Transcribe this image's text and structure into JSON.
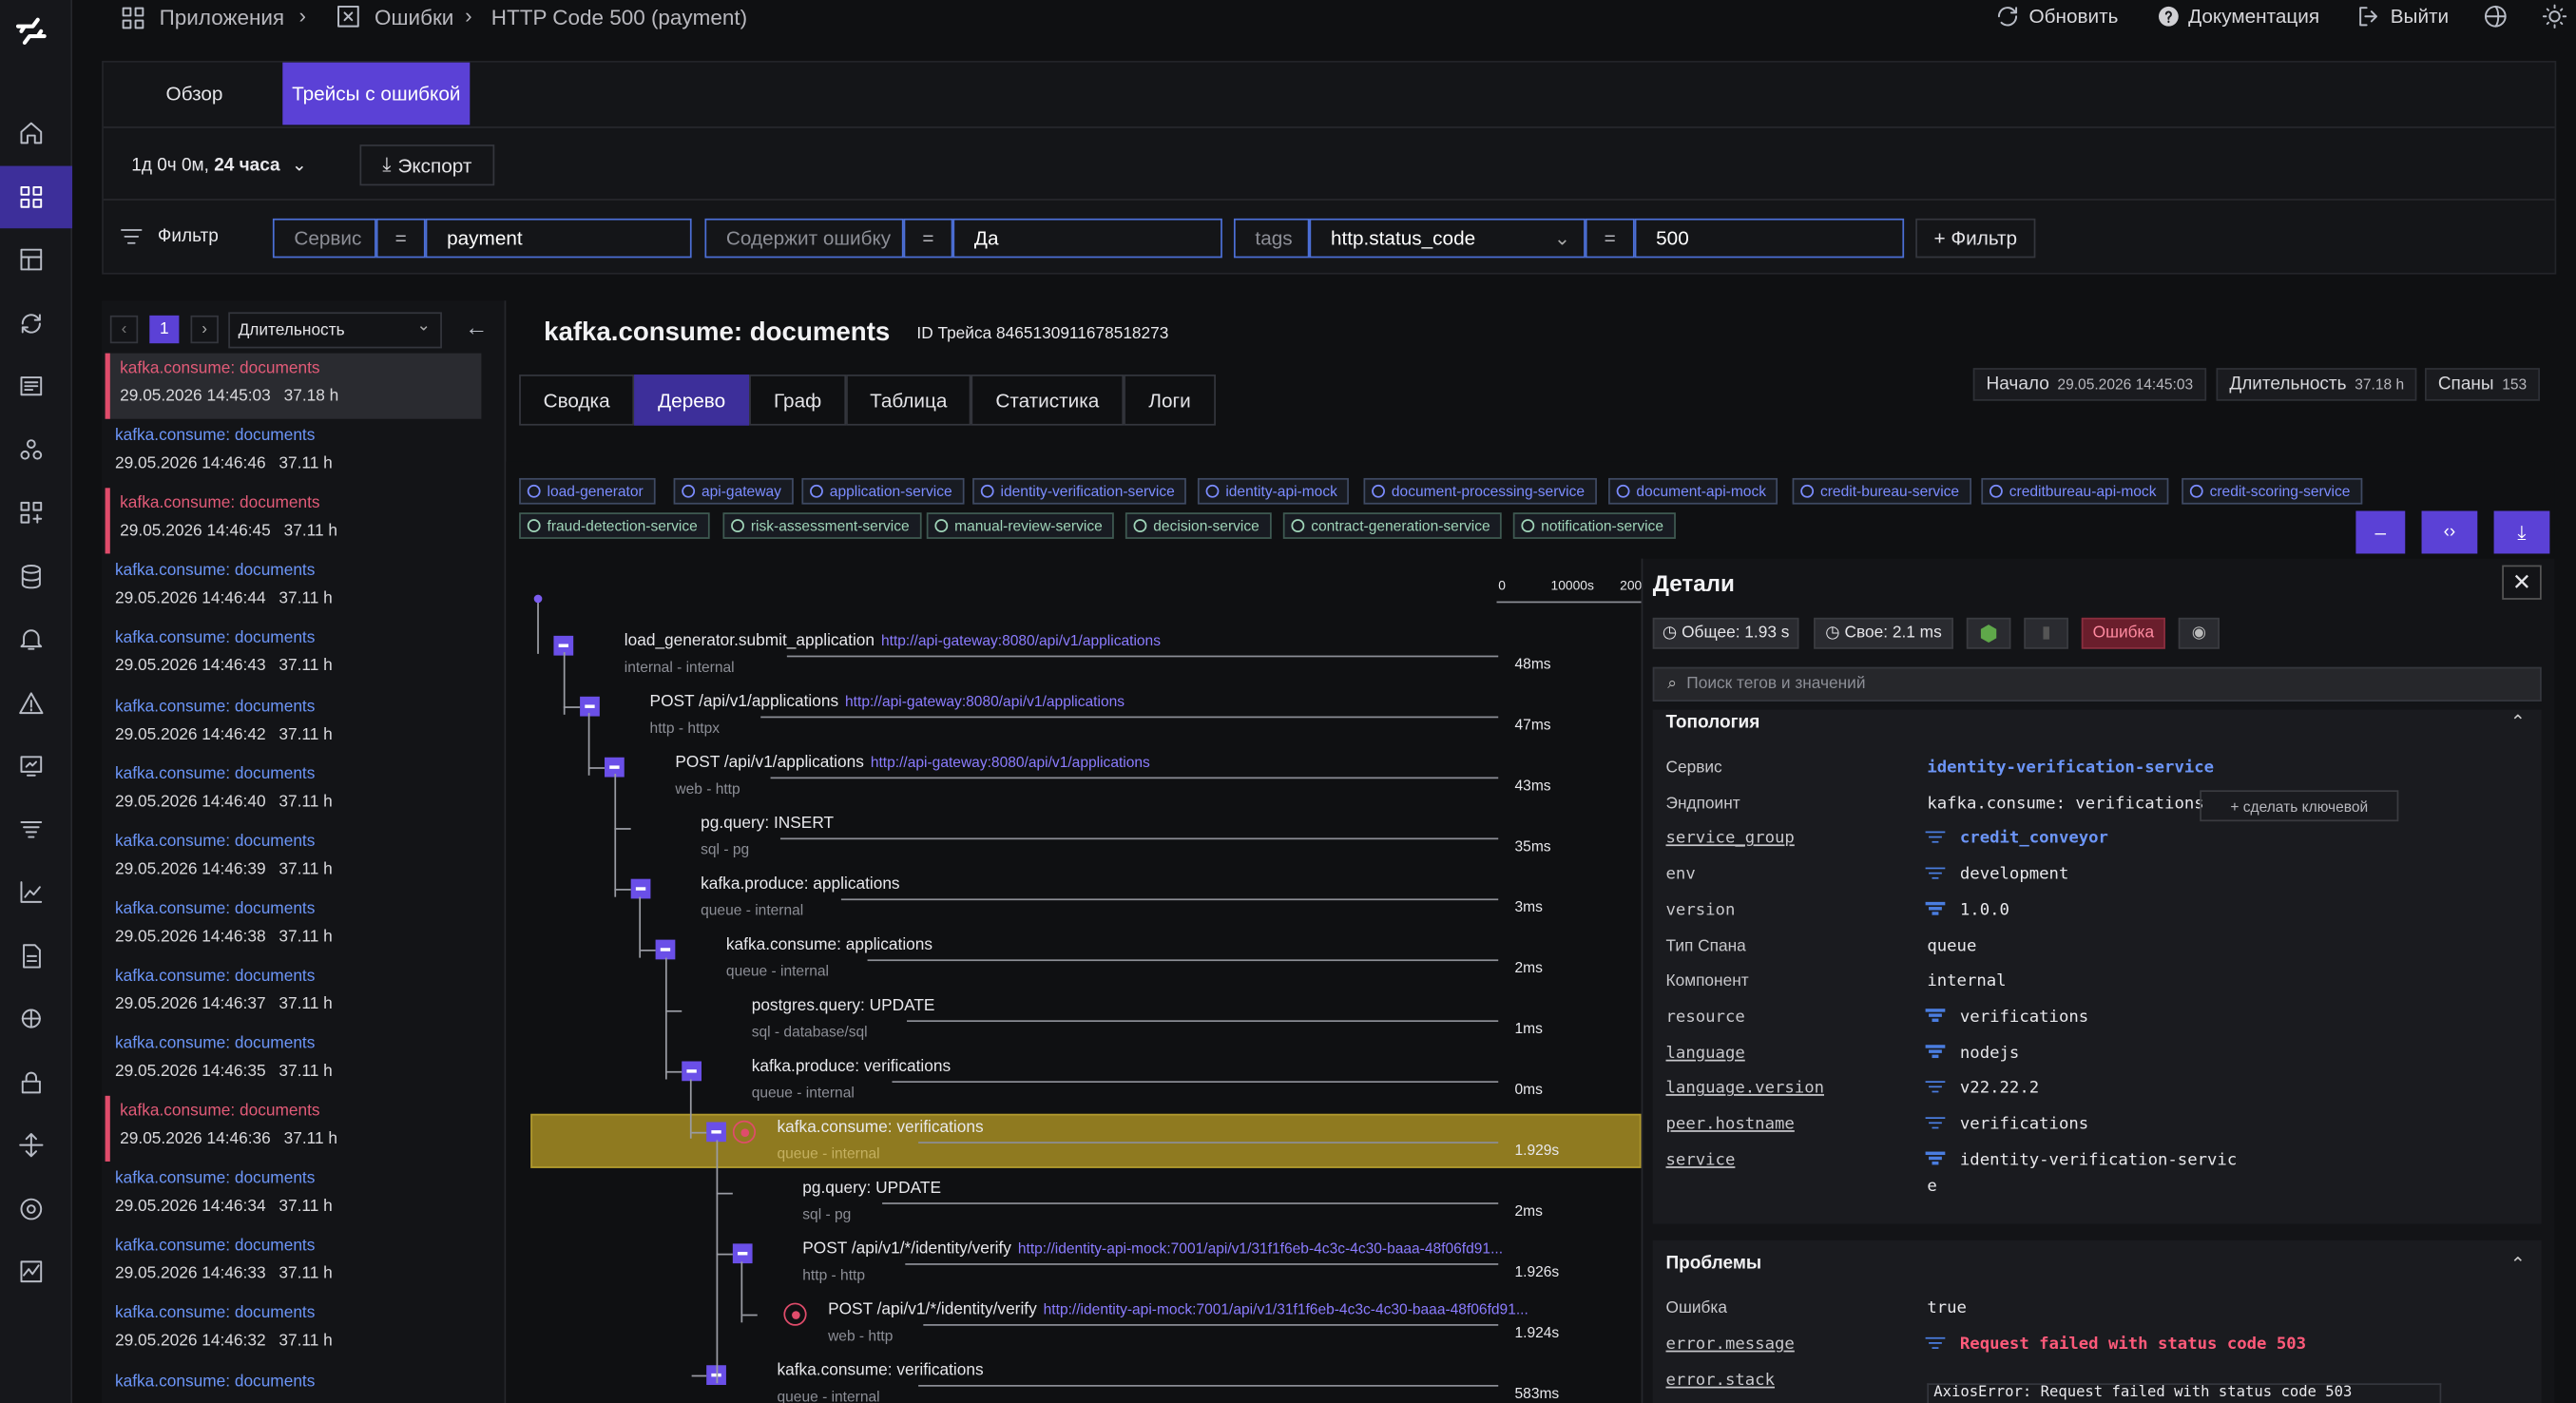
{
  "breadcrumb": {
    "apps": "Приложения",
    "errors": "Ошибки",
    "current": "HTTP Code 500 (payment)"
  },
  "topbar": {
    "refresh": "Обновить",
    "docs": "Документация",
    "logout": "Выйти"
  },
  "page_tabs": {
    "overview": "Обзор",
    "traces": "Трейсы с ошибкой"
  },
  "time_range": {
    "prefix": "1д 0ч 0м,",
    "bold": "24 часа"
  },
  "export_label": "Экспорт",
  "filter": {
    "label": "Фильтр",
    "f1_key": "Сервис",
    "f1_op": "=",
    "f1_val": "payment",
    "f2_key": "Содержит ошибку",
    "f2_op": "=",
    "f2_val": "Да",
    "f3_key": "tags",
    "f3_sub": "http.status_code",
    "f3_op": "=",
    "f3_val": "500",
    "add": "+ Фильтр"
  },
  "list": {
    "page": "1",
    "sort": "Длительность",
    "items": [
      {
        "name": "kafka.consume: documents",
        "date": "29.05.2026 14:45:03",
        "dur": "37.18 h",
        "error": true
      },
      {
        "name": "kafka.consume: documents",
        "date": "29.05.2026 14:46:46",
        "dur": "37.11 h",
        "error": false
      },
      {
        "name": "kafka.consume: documents",
        "date": "29.05.2026 14:46:45",
        "dur": "37.11 h",
        "error": true
      },
      {
        "name": "kafka.consume: documents",
        "date": "29.05.2026 14:46:44",
        "dur": "37.11 h",
        "error": false
      },
      {
        "name": "kafka.consume: documents",
        "date": "29.05.2026 14:46:43",
        "dur": "37.11 h",
        "error": false
      },
      {
        "name": "kafka.consume: documents",
        "date": "29.05.2026 14:46:42",
        "dur": "37.11 h",
        "error": false
      },
      {
        "name": "kafka.consume: documents",
        "date": "29.05.2026 14:46:40",
        "dur": "37.11 h",
        "error": false
      },
      {
        "name": "kafka.consume: documents",
        "date": "29.05.2026 14:46:39",
        "dur": "37.11 h",
        "error": false
      },
      {
        "name": "kafka.consume: documents",
        "date": "29.05.2026 14:46:38",
        "dur": "37.11 h",
        "error": false
      },
      {
        "name": "kafka.consume: documents",
        "date": "29.05.2026 14:46:37",
        "dur": "37.11 h",
        "error": false
      },
      {
        "name": "kafka.consume: documents",
        "date": "29.05.2026 14:46:35",
        "dur": "37.11 h",
        "error": false
      },
      {
        "name": "kafka.consume: documents",
        "date": "29.05.2026 14:46:36",
        "dur": "37.11 h",
        "error": true
      },
      {
        "name": "kafka.consume: documents",
        "date": "29.05.2026 14:46:34",
        "dur": "37.11 h",
        "error": false
      },
      {
        "name": "kafka.consume: documents",
        "date": "29.05.2026 14:46:33",
        "dur": "37.11 h",
        "error": false
      },
      {
        "name": "kafka.consume: documents",
        "date": "29.05.2026 14:46:32",
        "dur": "37.11 h",
        "error": false
      },
      {
        "name": "kafka.consume: documents",
        "date": "",
        "dur": "",
        "error": false
      }
    ]
  },
  "trace": {
    "title": "kafka.consume: documents",
    "id_label": "ID Трейса",
    "id": "8465130911678518273",
    "start_label": "Начало",
    "start": "29.05.2026 14:45:03",
    "duration_label": "Длительность",
    "duration": "37.18 h",
    "spans_label": "Спаны",
    "spans": "153",
    "tabs": [
      "Сводка",
      "Дерево",
      "Граф",
      "Таблица",
      "Статистика",
      "Логи"
    ],
    "services_row1": [
      "load-generator",
      "api-gateway",
      "application-service",
      "identity-verification-service",
      "identity-api-mock",
      "document-processing-service",
      "document-api-mock",
      "credit-bureau-service",
      "creditbureau-api-mock",
      "credit-scoring-service"
    ],
    "services_row2": [
      "fraud-detection-service",
      "risk-assessment-service",
      "manual-review-service",
      "decision-service",
      "contract-generation-service",
      "notification-service"
    ],
    "scale": [
      "0",
      "10000s",
      "200"
    ]
  },
  "spans": [
    {
      "name": "load_generator.submit_application",
      "url": "http://api-gateway:8080/api/v1/applications",
      "sub": "internal - internal",
      "dur": "48ms"
    },
    {
      "name": "POST /api/v1/applications",
      "url": "http://api-gateway:8080/api/v1/applications",
      "sub": "http - httpx",
      "dur": "47ms"
    },
    {
      "name": "POST /api/v1/applications",
      "url": "http://api-gateway:8080/api/v1/applications",
      "sub": "web - http",
      "dur": "43ms"
    },
    {
      "name": "pg.query: INSERT",
      "url": "",
      "sub": "sql - pg",
      "dur": "35ms"
    },
    {
      "name": "kafka.produce: applications",
      "url": "",
      "sub": "queue - internal",
      "dur": "3ms"
    },
    {
      "name": "kafka.consume: applications",
      "url": "",
      "sub": "queue - internal",
      "dur": "2ms"
    },
    {
      "name": "postgres.query: UPDATE",
      "url": "",
      "sub": "sql - database/sql",
      "dur": "1ms"
    },
    {
      "name": "kafka.produce: verifications",
      "url": "",
      "sub": "queue - internal",
      "dur": "0ms"
    },
    {
      "name": "kafka.consume: verifications",
      "url": "",
      "sub": "queue - internal",
      "dur": "1.929s"
    },
    {
      "name": "pg.query: UPDATE",
      "url": "",
      "sub": "sql - pg",
      "dur": "2ms"
    },
    {
      "name": "POST /api/v1/*/identity/verify",
      "url": "http://identity-api-mock:7001/api/v1/31f1f6eb-4c3c-4c30-baaa-48f06fd91...",
      "sub": "http - http",
      "dur": "1.926s"
    },
    {
      "name": "POST /api/v1/*/identity/verify",
      "url": "http://identity-api-mock:7001/api/v1/31f1f6eb-4c3c-4c30-baaa-48f06fd91...",
      "sub": "web - http",
      "dur": "1.924s"
    },
    {
      "name": "kafka.consume: verifications",
      "url": "",
      "sub": "queue - internal",
      "dur": "583ms"
    }
  ],
  "details": {
    "title": "Детали",
    "total": "Общее: 1.93 s",
    "self": "Свое: 2.1 ms",
    "error_badge": "Ошибка",
    "search_placeholder": "Поиск тегов и значений",
    "topology_title": "Топология",
    "make_key": "+ сделать ключевой",
    "rows": [
      {
        "k": "Сервис",
        "v": "identity-verification-service"
      },
      {
        "k": "Эндпоинт",
        "v": "kafka.consume: verifications"
      },
      {
        "k": "service_group",
        "v": "credit_conveyor"
      },
      {
        "k": "env",
        "v": "development"
      },
      {
        "k": "version",
        "v": "1.0.0"
      },
      {
        "k": "Тип Спана",
        "v": "queue"
      },
      {
        "k": "Компонент",
        "v": "internal"
      },
      {
        "k": "resource",
        "v": "verifications"
      },
      {
        "k": "language",
        "v": "nodejs"
      },
      {
        "k": "language.version",
        "v": "v22.22.2"
      },
      {
        "k": "peer.hostname",
        "v": "verifications"
      },
      {
        "k": "service",
        "v": "identity-verification-servic"
      }
    ],
    "service_wrap": "e",
    "problems_title": "Проблемы",
    "prob_rows": [
      {
        "k": "Ошибка",
        "v": "true"
      },
      {
        "k": "error.message",
        "v": "Request failed with status code 503"
      },
      {
        "k": "error.stack",
        "v": ""
      }
    ],
    "stack_preview": "AxiosError: Request failed with status code 503"
  },
  "colors": {
    "accent": "#6a4fe8",
    "link": "#6c95f7",
    "error": "#e25b78",
    "selected_span": "#8f7a20"
  }
}
